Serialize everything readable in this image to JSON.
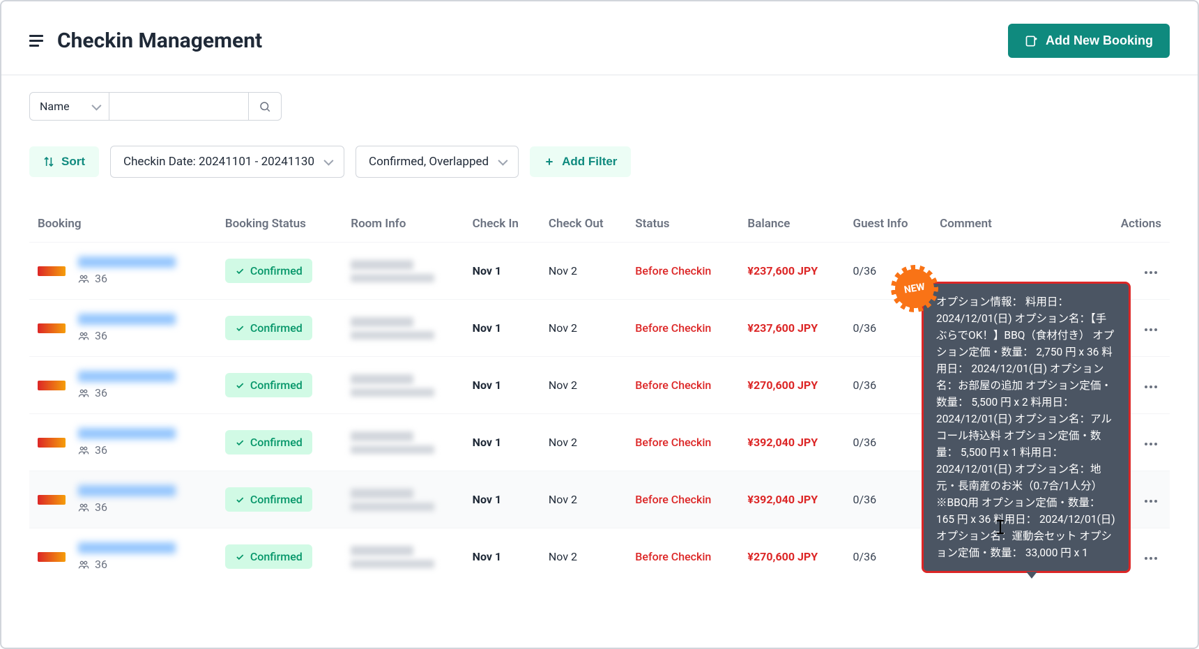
{
  "header": {
    "title": "Checkin Management",
    "add_button": "Add New Booking"
  },
  "search": {
    "filter_field": "Name",
    "input_value": "",
    "placeholder": ""
  },
  "controls": {
    "sort_label": "Sort",
    "date_chip": "Checkin Date: 20241101 - 20241130",
    "status_chip": "Confirmed, Overlapped",
    "add_filter": "Add Filter"
  },
  "columns": {
    "booking": "Booking",
    "booking_status": "Booking Status",
    "room_info": "Room Info",
    "check_in": "Check In",
    "check_out": "Check Out",
    "status": "Status",
    "balance": "Balance",
    "guest_info": "Guest Info",
    "comment": "Comment",
    "actions": "Actions"
  },
  "rows": [
    {
      "guest_count": "36",
      "booking_status": "Confirmed",
      "check_in": "Nov 1",
      "check_out": "Nov 2",
      "status": "Before Checkin",
      "balance": "¥237,600 JPY",
      "guest_info": "0/36",
      "comment": ""
    },
    {
      "guest_count": "36",
      "booking_status": "Confirmed",
      "check_in": "Nov 1",
      "check_out": "Nov 2",
      "status": "Before Checkin",
      "balance": "¥237,600 JPY",
      "guest_info": "0/36",
      "comment": ""
    },
    {
      "guest_count": "36",
      "booking_status": "Confirmed",
      "check_in": "Nov 1",
      "check_out": "Nov 2",
      "status": "Before Checkin",
      "balance": "¥270,600 JPY",
      "guest_info": "0/36",
      "comment": ""
    },
    {
      "guest_count": "36",
      "booking_status": "Confirmed",
      "check_in": "Nov 1",
      "check_out": "Nov 2",
      "status": "Before Checkin",
      "balance": "¥392,040 JPY",
      "guest_info": "0/36",
      "comment": ""
    },
    {
      "guest_count": "36",
      "booking_status": "Confirmed",
      "check_in": "Nov 1",
      "check_out": "Nov 2",
      "status": "Before Checkin",
      "balance": "¥392,040 JPY",
      "guest_info": "0/36",
      "comment": "オプション情報： 料用日： 20..."
    },
    {
      "guest_count": "36",
      "booking_status": "Confirmed",
      "check_in": "Nov 1",
      "check_out": "Nov 2",
      "status": "Before Checkin",
      "balance": "¥270,600 JPY",
      "guest_info": "0/36",
      "comment": "オプション情報： 料用日： 20..."
    }
  ],
  "tooltip": {
    "text": "オプション情報： 料用日： 2024/12/01(日) オプション名：【手ぶらでOK！】BBQ（食材付き） オプション定価・数量： 2,750 円 x 36 料用日： 2024/12/01(日) オプション名：お部屋の追加 オプション定価・数量： 5,500 円 x 2 料用日： 2024/12/01(日) オプション名：アルコール持込料 オプション定価・数量： 5,500 円 x 1 料用日： 2024/12/01(日) オプション名：地元・長南産のお米（0.7合/1人分）※BBQ用 オプション定価・数量： 165 円 x 36 料用日： 2024/12/01(日) オプション名：運動会セット オプション定価・数量： 33,000 円 x 1"
  },
  "badge": {
    "new": "NEW"
  }
}
